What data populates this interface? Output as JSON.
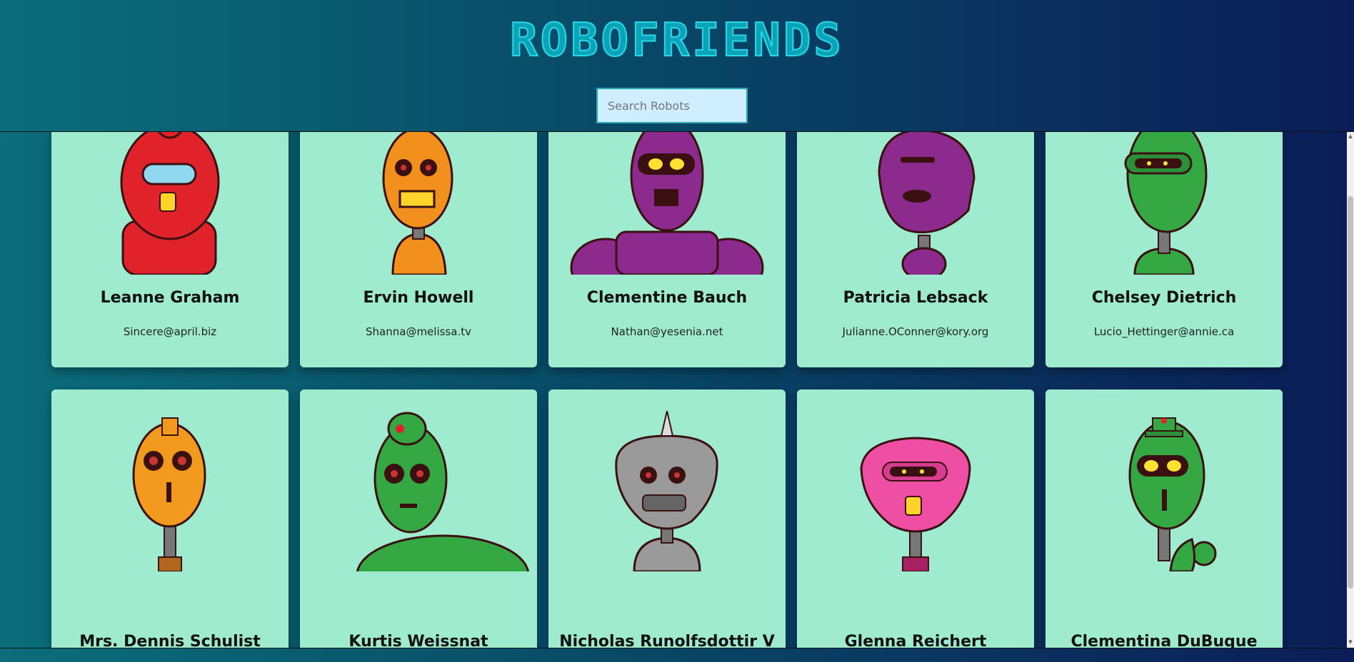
{
  "app": {
    "title": "ROBOFRIENDS"
  },
  "search": {
    "placeholder": "Search Robots",
    "value": ""
  },
  "robots": [
    {
      "name": "Leanne Graham",
      "email": "Sincere@april.biz",
      "color": "#e0232b"
    },
    {
      "name": "Ervin Howell",
      "email": "Shanna@melissa.tv",
      "color": "#f2901e"
    },
    {
      "name": "Clementine Bauch",
      "email": "Nathan@yesenia.net",
      "color": "#8c2a8e"
    },
    {
      "name": "Patricia Lebsack",
      "email": "Julianne.OConner@kory.org",
      "color": "#8c2a8e"
    },
    {
      "name": "Chelsey Dietrich",
      "email": "Lucio_Hettinger@annie.ca",
      "color": "#34a843"
    },
    {
      "name": "Mrs. Dennis Schulist",
      "email": "",
      "color": "#f29a1e"
    },
    {
      "name": "Kurtis Weissnat",
      "email": "",
      "color": "#34a843"
    },
    {
      "name": "Nicholas Runolfsdottir V",
      "email": "",
      "color": "#9a9a9a"
    },
    {
      "name": "Glenna Reichert",
      "email": "",
      "color": "#ee4fa5"
    },
    {
      "name": "Clementina DuBuque",
      "email": "",
      "color": "#34a843"
    }
  ]
}
